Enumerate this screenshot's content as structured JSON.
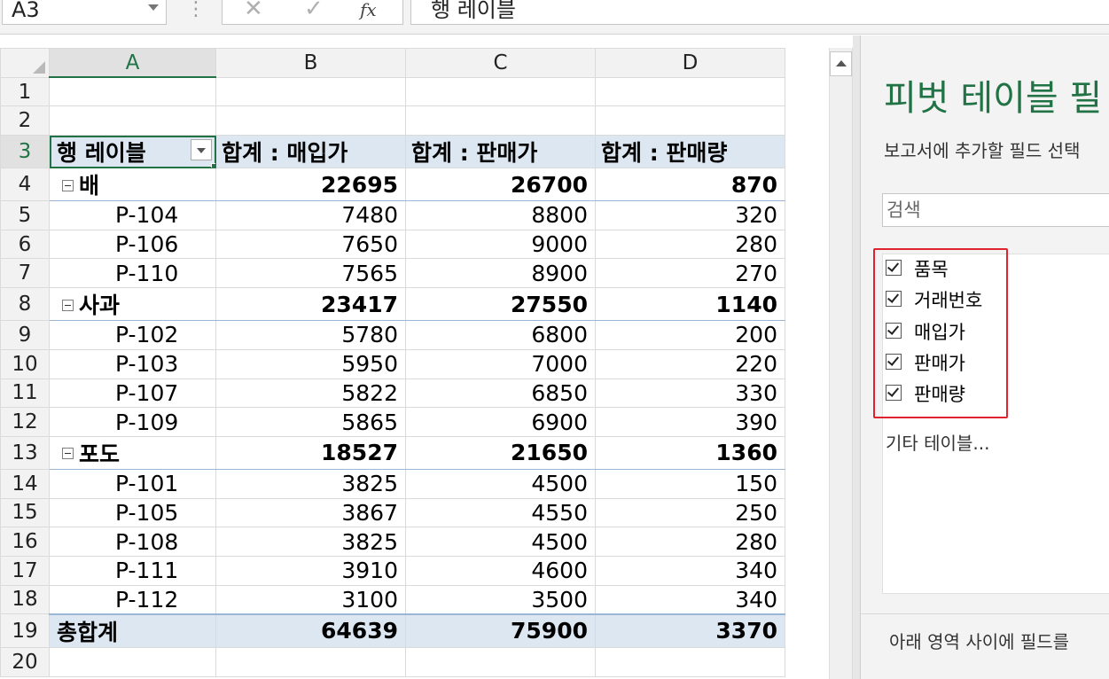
{
  "formula_bar": {
    "name_box": "A3",
    "cancel_icon": "✕",
    "enter_icon": "✓",
    "fx_label": "fx",
    "content": "행 레이블"
  },
  "columns": [
    "A",
    "B",
    "C",
    "D"
  ],
  "pivot": {
    "header": [
      "행 레이블",
      "합계 : 매입가",
      "합계 : 판매가",
      "합계 : 판매량"
    ],
    "groups": [
      {
        "name": "배",
        "totals": [
          "22695",
          "26700",
          "870"
        ],
        "items": [
          [
            "P-104",
            "7480",
            "8800",
            "320"
          ],
          [
            "P-106",
            "7650",
            "9000",
            "280"
          ],
          [
            "P-110",
            "7565",
            "8900",
            "270"
          ]
        ]
      },
      {
        "name": "사과",
        "totals": [
          "23417",
          "27550",
          "1140"
        ],
        "items": [
          [
            "P-102",
            "5780",
            "6800",
            "200"
          ],
          [
            "P-103",
            "5950",
            "7000",
            "220"
          ],
          [
            "P-107",
            "5822",
            "6850",
            "330"
          ],
          [
            "P-109",
            "5865",
            "6900",
            "390"
          ]
        ]
      },
      {
        "name": "포도",
        "totals": [
          "18527",
          "21650",
          "1360"
        ],
        "items": [
          [
            "P-101",
            "3825",
            "4500",
            "150"
          ],
          [
            "P-105",
            "3867",
            "4550",
            "250"
          ],
          [
            "P-108",
            "3825",
            "4500",
            "280"
          ],
          [
            "P-111",
            "3910",
            "4600",
            "340"
          ],
          [
            "P-112",
            "3100",
            "3500",
            "340"
          ]
        ]
      }
    ],
    "grand_total": [
      "총합계",
      "64639",
      "75900",
      "3370"
    ]
  },
  "pane": {
    "title": "피벗 테이블 필",
    "subtitle": "보고서에 추가할 필드 선택",
    "search_placeholder": "검색",
    "fields": [
      "품목",
      "거래번호",
      "매입가",
      "판매가",
      "판매량"
    ],
    "more_tables": "기타 테이블...",
    "footer_hint": "아래 영역 사이에 필드를"
  }
}
